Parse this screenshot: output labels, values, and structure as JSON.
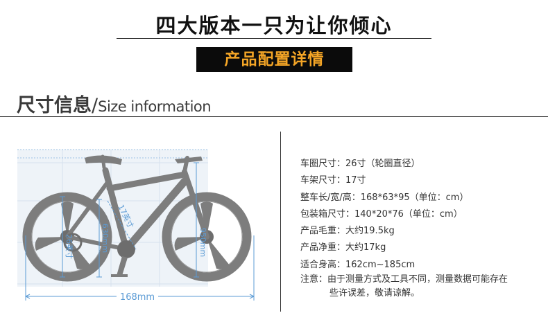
{
  "header": {
    "title": "四大版本一只为让你倾心",
    "config_banner": "产品配置详情"
  },
  "section": {
    "title_zh": "尺寸信息",
    "slash": "/",
    "title_en": "Size information"
  },
  "diagram": {
    "labels": {
      "wheel": "26英寸",
      "seat_height": "630mm",
      "frame": "17英寸",
      "total_height": "950mm",
      "wheelbase": "168mm"
    },
    "colors": {
      "bike": "#7d7d7d",
      "dimension_line": "#5b9bd5",
      "grid_bg": "#edf3f9"
    }
  },
  "specs": [
    {
      "label": "车圈尺寸：",
      "value": "26寸（轮圈直径）"
    },
    {
      "label": "车架尺寸：",
      "value": "17寸"
    },
    {
      "label": "整车长/宽/高：",
      "value": "168*63*95（单位：cm）"
    },
    {
      "label": "包装箱尺寸：",
      "value": "140*20*76（单位：cm）"
    },
    {
      "label": "产品毛重：",
      "value": "大约19.5kg"
    },
    {
      "label": "产品净重：",
      "value": "大约17kg"
    },
    {
      "label": "适合身高：",
      "value": "162cm~185cm"
    }
  ],
  "note": {
    "label": "注意：",
    "line1": "由于测量方式及工具不同，测量数据可能存在",
    "line2": "些许误差，敬请谅解。"
  }
}
